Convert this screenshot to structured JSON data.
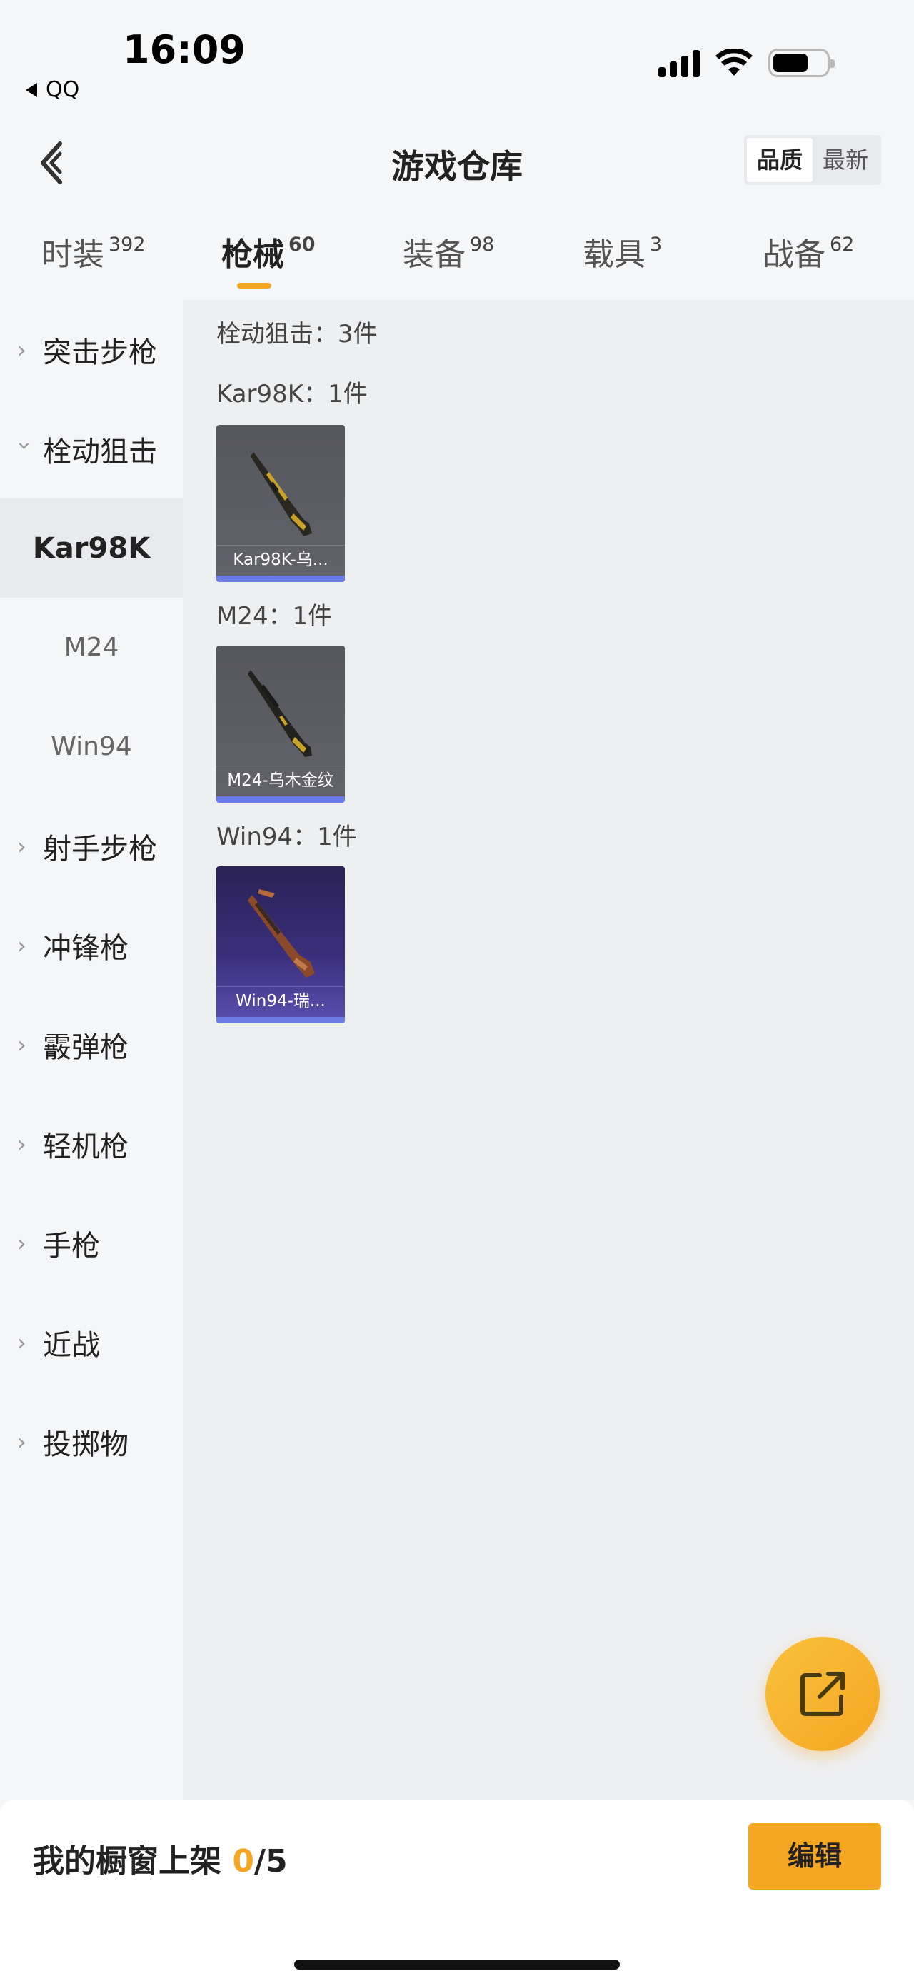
{
  "status_bar": {
    "time": "16:09",
    "back_app": "QQ"
  },
  "header": {
    "title": "游戏仓库",
    "sort_options": [
      "品质",
      "最新"
    ],
    "sort_selected": "品质"
  },
  "category_tabs": [
    {
      "label": "时装",
      "count": "392",
      "active": false
    },
    {
      "label": "枪械",
      "count": "60",
      "active": true
    },
    {
      "label": "装备",
      "count": "98",
      "active": false
    },
    {
      "label": "载具",
      "count": "3",
      "active": false
    },
    {
      "label": "战备",
      "count": "62",
      "active": false
    }
  ],
  "sidebar": {
    "items": [
      {
        "label": "突击步枪"
      },
      {
        "label": "栓动狙击"
      },
      {
        "label": "Kar98K"
      },
      {
        "label": "M24"
      },
      {
        "label": "Win94"
      },
      {
        "label": "射手步枪"
      },
      {
        "label": "冲锋枪"
      },
      {
        "label": "霰弹枪"
      },
      {
        "label": "轻机枪"
      },
      {
        "label": "手枪"
      },
      {
        "label": "近战"
      },
      {
        "label": "投掷物"
      }
    ],
    "selected": "Kar98K"
  },
  "main": {
    "section_title": "栓动狙击：3件",
    "groups": [
      {
        "title": "Kar98K：1件",
        "item_name": "Kar98K-乌...",
        "theme": "grey"
      },
      {
        "title": "M24：1件",
        "item_name": "M24-乌木金纹",
        "theme": "grey"
      },
      {
        "title": "Win94：1件",
        "item_name": "Win94-瑞...",
        "theme": "purple"
      }
    ]
  },
  "fab": {
    "icon": "share-external-icon"
  },
  "bottom_bar": {
    "showcase_label": "我的橱窗上架",
    "current": "0",
    "total": "/5",
    "edit_label": "编辑"
  },
  "colors": {
    "accent": "#f5a623",
    "rarity_blue": "#6c7ce6"
  }
}
